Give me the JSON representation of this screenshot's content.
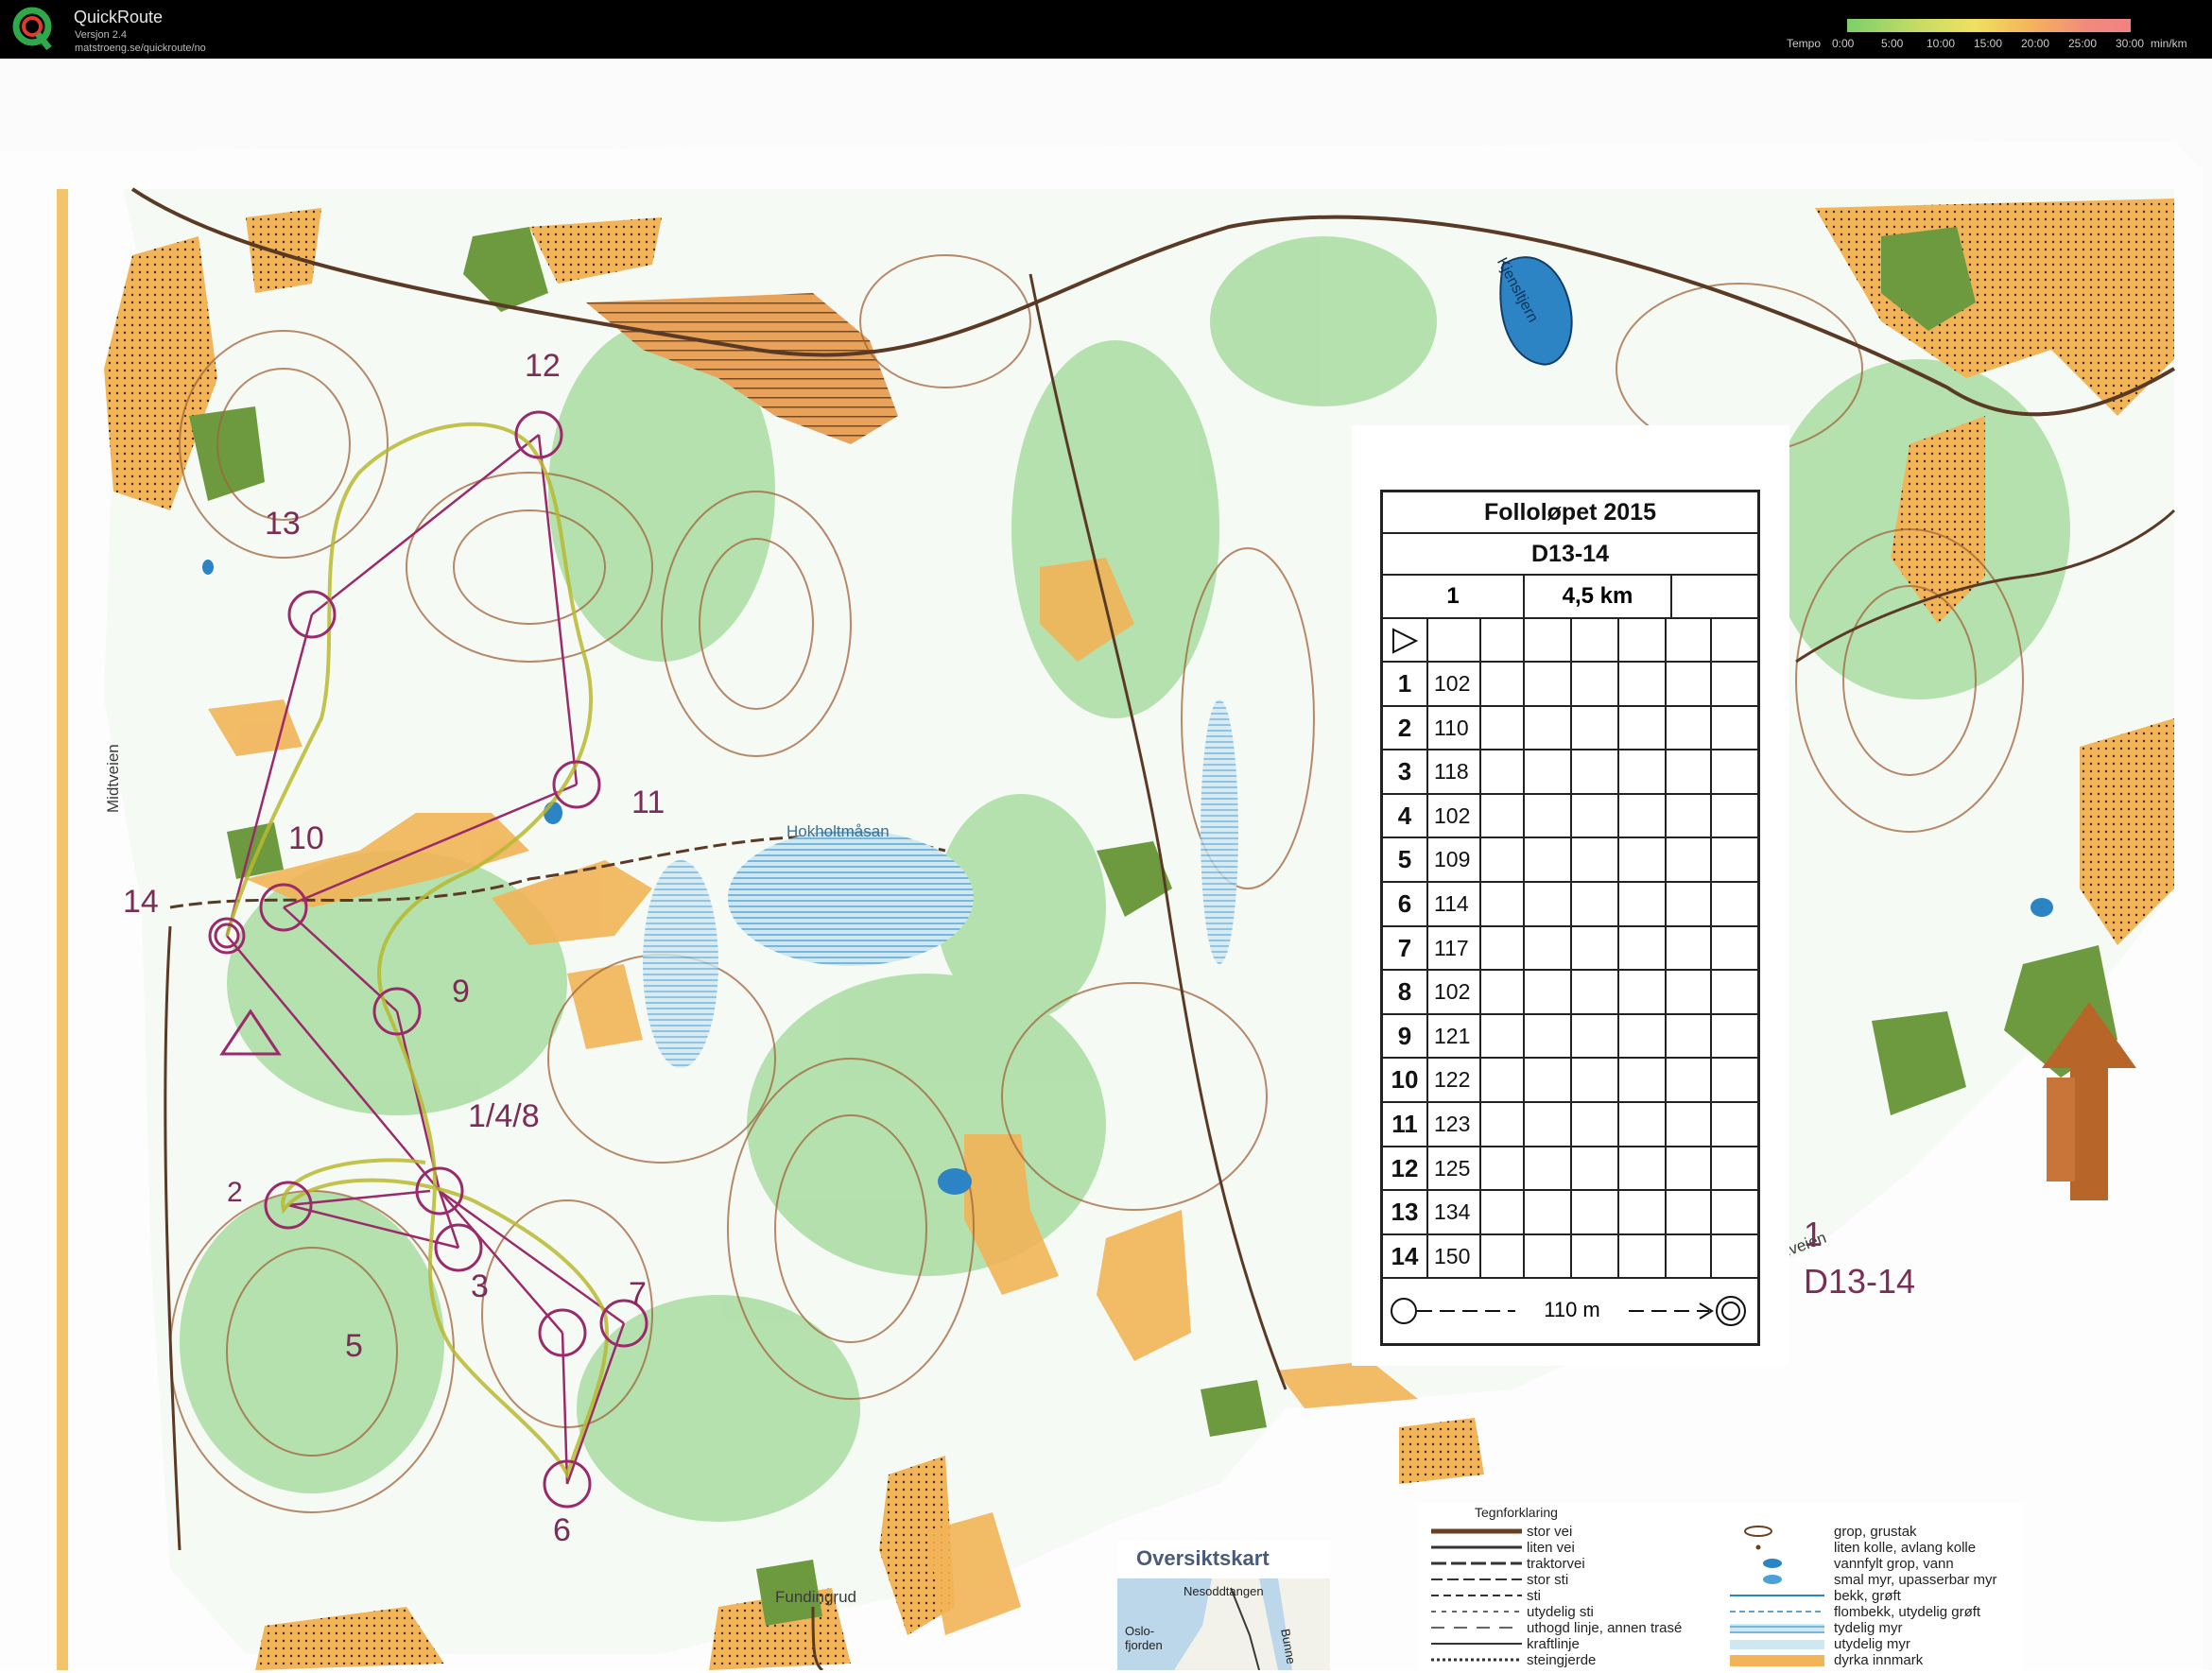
{
  "app": {
    "title": "QuickRoute",
    "version": "Versjon 2.4",
    "url": "matstroeng.se/quickroute/no"
  },
  "tempo_legend": {
    "label": "Tempo",
    "ticks": [
      "0:00",
      "5:00",
      "10:00",
      "15:00",
      "20:00",
      "25:00",
      "30:00"
    ],
    "unit": "min/km"
  },
  "control_card": {
    "event": "Folloløpet 2015",
    "class": "D13-14",
    "course": "1",
    "length": "4,5 km",
    "controls": [
      {
        "num": "1",
        "code": "102"
      },
      {
        "num": "2",
        "code": "110"
      },
      {
        "num": "3",
        "code": "118"
      },
      {
        "num": "4",
        "code": "102"
      },
      {
        "num": "5",
        "code": "109"
      },
      {
        "num": "6",
        "code": "114"
      },
      {
        "num": "7",
        "code": "117"
      },
      {
        "num": "8",
        "code": "102"
      },
      {
        "num": "9",
        "code": "121"
      },
      {
        "num": "10",
        "code": "122"
      },
      {
        "num": "11",
        "code": "123"
      },
      {
        "num": "12",
        "code": "125"
      },
      {
        "num": "13",
        "code": "134"
      },
      {
        "num": "14",
        "code": "150"
      }
    ],
    "finish_distance": "110 m"
  },
  "map_labels": {
    "lake": "Hokholtmåsan",
    "tarn": "Kjensltjern",
    "road_left": "Midtveien",
    "road_right": "udveien",
    "road_bottom": "Fundingrud",
    "course_number": "1",
    "course_class": "D13-14"
  },
  "course_control_labels": [
    "1/4/8",
    "2",
    "3",
    "5",
    "6",
    "7",
    "9",
    "10",
    "11",
    "12",
    "13",
    "14"
  ],
  "overview_map": {
    "title": "Oversiktskart",
    "place_top": "Nesoddtangen",
    "place_left": "Oslo-fjorden",
    "place_right": "Bunne"
  },
  "legend": {
    "title": "Tegnforklaring",
    "left": [
      "stor vei",
      "liten vei",
      "traktorvei",
      "stor sti",
      "sti",
      "utydelig sti",
      "uthogd linje, annen trasé",
      "kraftlinje",
      "steingjerde"
    ],
    "right": [
      "grop, grustak",
      "liten kolle, avlang kolle",
      "vannfylt grop, vann",
      "smal myr, upasserbar myr",
      "bekk, grøft",
      "flombekk, utydelig grøft",
      "tydelig myr",
      "utydelig myr",
      "dyrka innmark"
    ]
  },
  "colors": {
    "open_land": "#f2b457",
    "forest": "#ffffff",
    "green": "#9ed39a",
    "contour": "#9a5a2c",
    "course": "#9b2a6b",
    "water": "#2c84c4"
  }
}
